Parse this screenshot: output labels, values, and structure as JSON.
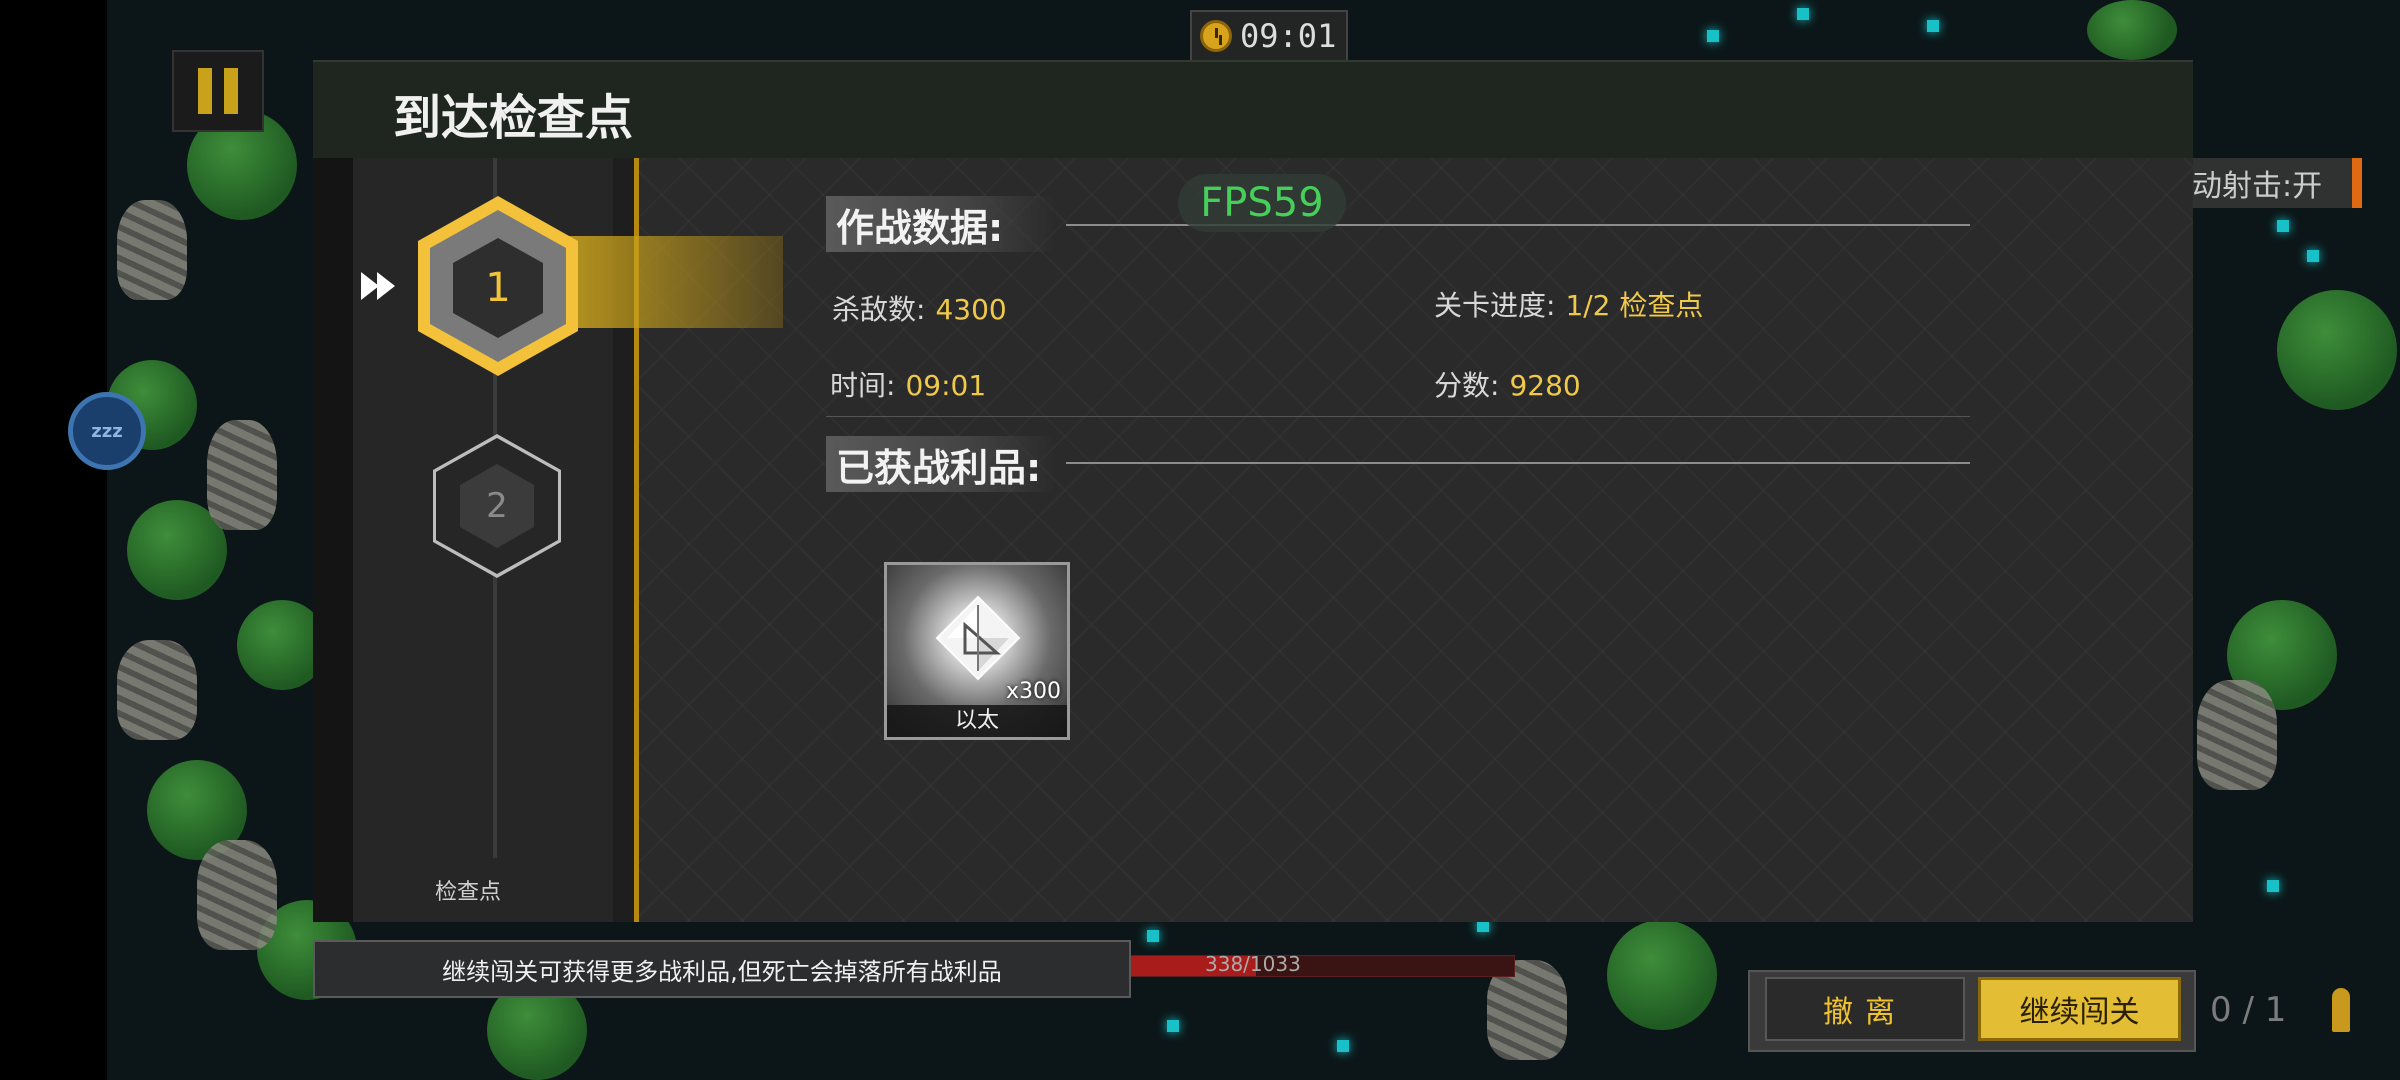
{
  "hud": {
    "timer": "09:01",
    "sleep_badge": "zzz",
    "auto_shoot": "动射击:开",
    "hp_text": "338/1033",
    "hp_fraction": 0.327,
    "ammo": "0 / 1"
  },
  "dialog": {
    "title": "到达检查点",
    "checkpoints": [
      {
        "number": "1",
        "active": true
      },
      {
        "number": "2",
        "active": false
      }
    ],
    "checkpoint_label": "检查点",
    "fps": "FPS59",
    "combat_section": {
      "heading": "作战数据:",
      "kills_label": "杀敌数:",
      "kills_value": "4300",
      "progress_label": "关卡进度:",
      "progress_value": "1/2 检查点",
      "time_label": "时间:",
      "time_value": "09:01",
      "score_label": "分数:",
      "score_value": "9280"
    },
    "loot_section": {
      "heading": "已获战利品:",
      "items": [
        {
          "name": "以太",
          "quantity": "x300",
          "icon": "ether-crystal-icon"
        }
      ]
    },
    "tip": "继续闯关可获得更多战利品,但死亡会掉落所有战利品",
    "retreat_label": "撤离",
    "continue_label": "继续闯关"
  },
  "colors": {
    "accent_gold": "#e3bd34",
    "value_yellow": "#f0c94a",
    "fps_green": "#46d05a",
    "hp_red": "#a81c1c"
  }
}
